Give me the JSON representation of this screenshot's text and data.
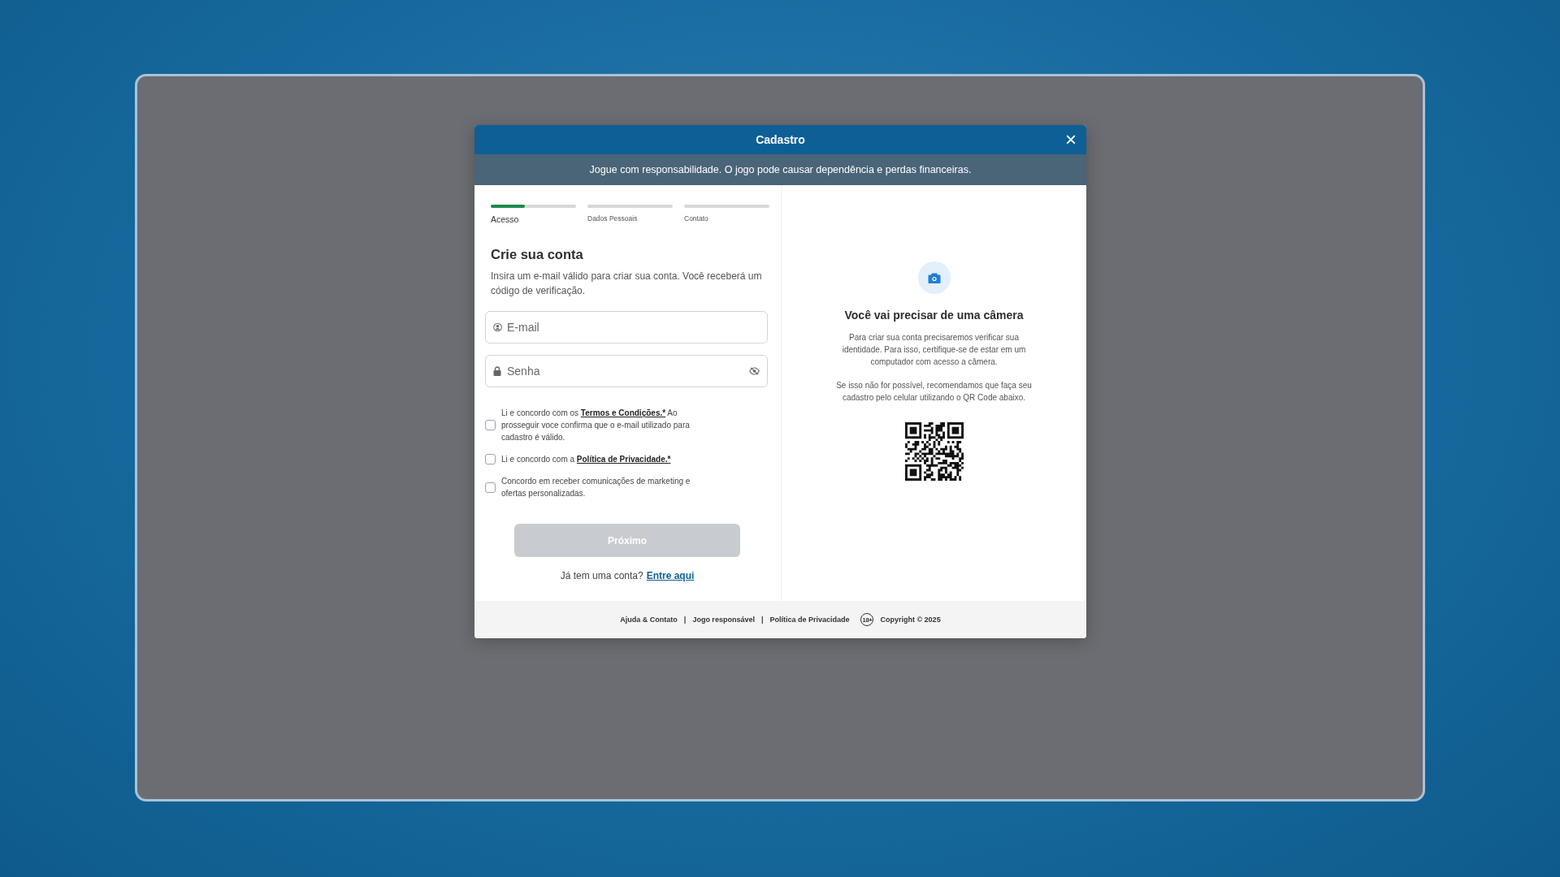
{
  "modal": {
    "title": "Cadastro",
    "close": "×"
  },
  "notice": "Jogue com responsabilidade. O jogo pode causar dependência e perdas financeiras.",
  "steps": [
    {
      "label": "Acesso",
      "selected": true,
      "level": 0.4
    },
    {
      "label": "Dados Pessoais",
      "selected": false
    },
    {
      "label": "Contato",
      "selected": false
    }
  ],
  "form": {
    "heading": "Crie sua conta",
    "description": "Insira um e-mail válido para criar sua conta. Você receberá um código de verificação.",
    "fields": [
      {
        "kind": "email",
        "placeholder": "E-mail"
      },
      {
        "kind": "password",
        "placeholder": "Senha"
      }
    ],
    "checkboxes": [
      {
        "text_before": "Li e concordo com os ",
        "link": "Termos e Condições.*",
        "text_after": " Ao prosseguir voce confirma que o e-mail utilizado para cadastro é válido.",
        "checked": false
      },
      {
        "text_before": "Li e concordo com a ",
        "link": "Política de Privacidade.*",
        "checked": false
      },
      {
        "text_before": "Concordo em receber comunicações de marketing e ofertas personalizadas.",
        "checked": false
      }
    ],
    "next_button": {
      "label": "Próximo",
      "disabled": true
    },
    "login_prompt": "Já tem uma conta?",
    "login_link": "Entre aqui"
  },
  "camera_panel": {
    "heading": "Você vai precisar de uma câmera",
    "paragraphs": [
      "Para criar sua conta precisaremos verificar sua identidade. Para isso, certifique-se de estar em um computador com acesso a câmera.",
      "Se isso não for possível, recomendamos que faça seu cadastro pelo celular utilizando o QR Code abaixo."
    ]
  },
  "footer": {
    "links": [
      "Ajuda & Contato",
      "Jogo responsável",
      "Política de Privacidade"
    ],
    "separator": "|",
    "age_badge": "18+",
    "copyright": "Copyright © 2025"
  }
}
